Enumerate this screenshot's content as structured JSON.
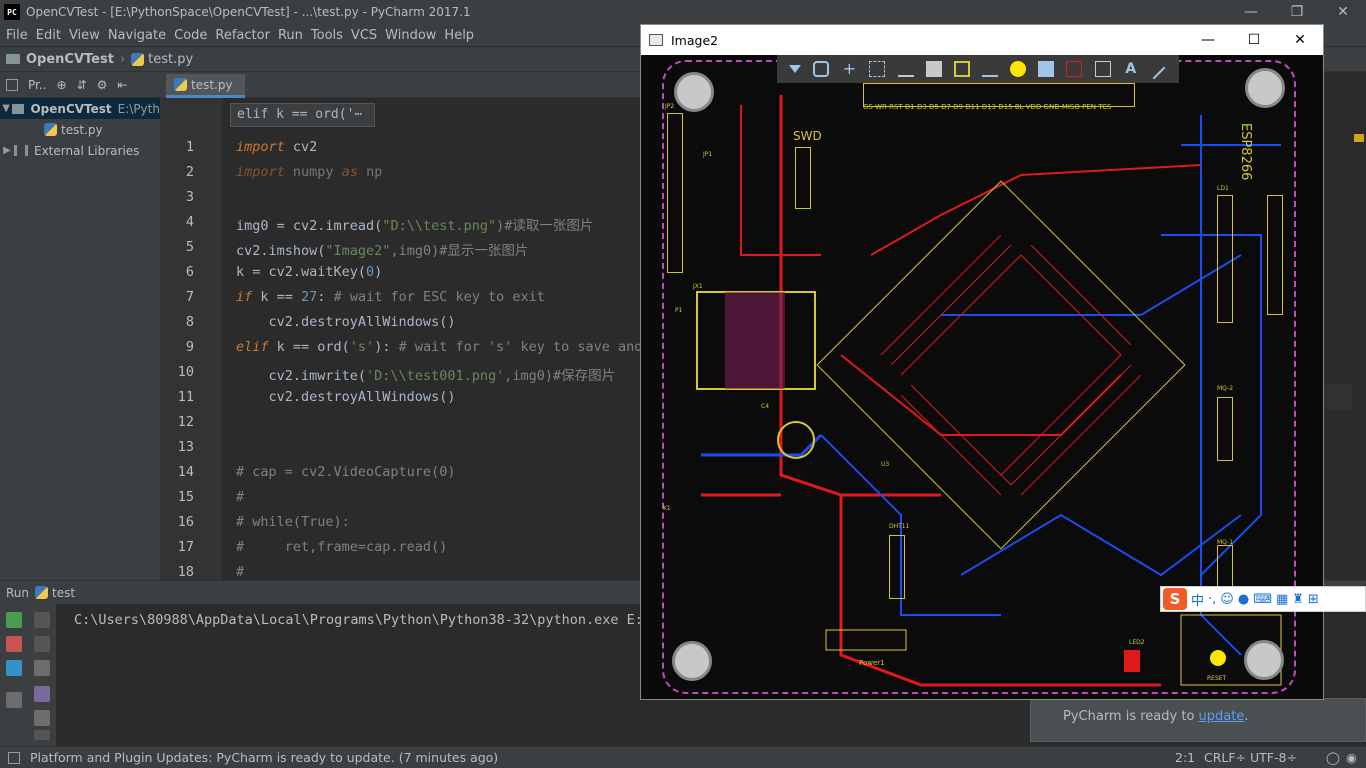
{
  "window": {
    "title": "OpenCVTest - [E:\\PythonSpace\\OpenCVTest] - ...\\test.py - PyCharm 2017.1",
    "logo": "PC"
  },
  "menu": [
    "File",
    "Edit",
    "View",
    "Navigate",
    "Code",
    "Refactor",
    "Run",
    "Tools",
    "VCS",
    "Window",
    "Help"
  ],
  "navbar": {
    "project": "OpenCVTest",
    "file": "test.py"
  },
  "project_panel": {
    "selector": "Pr..",
    "root_label": "OpenCVTest",
    "root_path": "E:\\Pyth",
    "file": "test.py",
    "libs": "External Libraries"
  },
  "editor": {
    "tab": "test.py",
    "tooltip": "elif k == ord('⋯",
    "line_numbers": [
      "1",
      "2",
      "3",
      "4",
      "5",
      "6",
      "7",
      "8",
      "9",
      "10",
      "11",
      "12",
      "13",
      "14",
      "15",
      "16",
      "17",
      "18"
    ]
  },
  "code": {
    "l1_kw": "import",
    "l1_rest": " cv2",
    "l2_kw": "import",
    "l2_mid": " numpy ",
    "l2_as": "as",
    "l2_rest": " np",
    "l4_a": "img0 = cv2.imread(",
    "l4_s": "\"D:\\\\test.png\"",
    "l4_c": ")#读取一张图片",
    "l5_a": "cv2.imshow(",
    "l5_s": "\"Image2\"",
    "l5_c": ",img0)#显示一张图片",
    "l6_a": "k = cv2.waitKey(",
    "l6_n": "0",
    "l6_b": ")",
    "l7_kw": "if",
    "l7_a": " k == ",
    "l7_n": "27",
    "l7_b": ": ",
    "l7_c": "# wait for ESC key to exit",
    "l8": "    cv2.destroyAllWindows()",
    "l9_kw": "elif",
    "l9_a": " k == ord(",
    "l9_s": "'s'",
    "l9_b": "): ",
    "l9_c": "# wait for 's' key to save and",
    "l10_a": "    cv2.imwrite(",
    "l10_s": "'D:\\\\test001.png'",
    "l10_b": ",img0)#保存图片",
    "l11": "    cv2.destroyAllWindows()",
    "l14": "# cap = cv2.VideoCapture(0)",
    "l15": "#",
    "l16": "# while(True):",
    "l17": "#     ret,frame=cap.read()",
    "l18": "#"
  },
  "run": {
    "label": "Run",
    "config": "test",
    "console": "C:\\Users\\80988\\AppData\\Local\\Programs\\Python\\Python38-32\\python.exe E:/"
  },
  "notification": {
    "text": "PyCharm is ready to ",
    "link": "update",
    "tail": "."
  },
  "status": {
    "message": "Platform and Plugin Updates: PyCharm is ready to update. (7 minutes ago)",
    "position": "2:1",
    "line_sep": "CRLF÷",
    "encoding": "UTF-8÷"
  },
  "image_window": {
    "title": "Image2",
    "pcb_labels": {
      "swd": "SWD",
      "esp": "ESP8266",
      "power": "Power1",
      "reset": "RESET",
      "led2": "LED2",
      "dht11": "DHT11",
      "u3": "U3",
      "jx1": "JX1",
      "jp1": "JP1",
      "k1": "K1",
      "c4": "C4",
      "p1": "P1",
      "jp2": "JP2",
      "mq2": "MQ-2",
      "mq1": "MQ-1",
      "ld1": "LD1"
    },
    "pin_header_top": "GS WR RST D1 D3 D5 D7 D9 D11 D13 D15 BL VDD GND MISO PEN TCS"
  },
  "ime": {
    "logo": "S",
    "lang": "中"
  },
  "colors": {
    "ide_bg": "#2b2b2b",
    "panel": "#3c3f41",
    "keyword": "#cc7832",
    "string": "#6a8759",
    "number": "#6897bb",
    "comment": "#808080",
    "pcb_red": "#e0191c",
    "pcb_blue": "#1a4cf0",
    "silkscreen": "#d7c936",
    "board_outline": "#c04cc0"
  }
}
